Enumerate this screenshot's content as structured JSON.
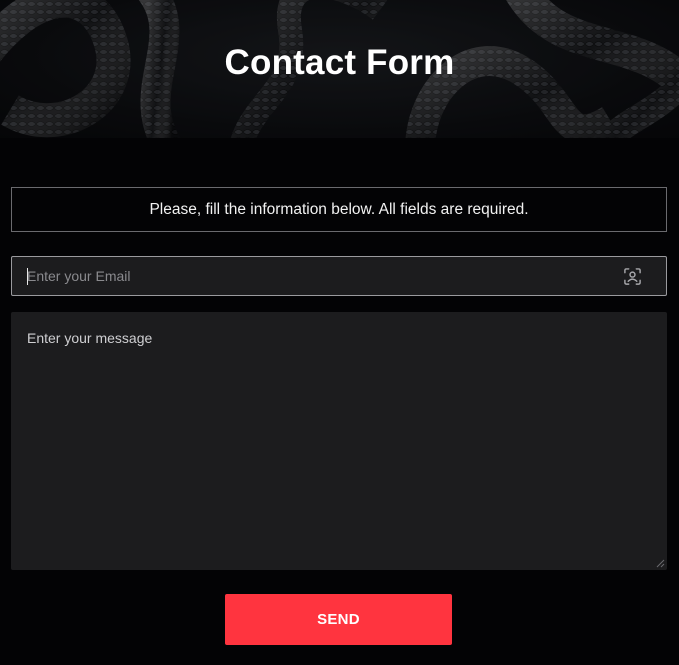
{
  "header": {
    "title": "Contact Form"
  },
  "form": {
    "info_text": "Please, fill the information below. All fields are required.",
    "email": {
      "placeholder": "Enter your Email",
      "value": ""
    },
    "message": {
      "placeholder": "Enter your message",
      "value": ""
    },
    "send_label": "SEND"
  },
  "icons": {
    "email_field_icon": "contact-card-icon",
    "textarea_resize": "resize-handle-icon"
  },
  "colors": {
    "background": "#030305",
    "field_background": "#1c1c1e",
    "accent": "#ff343f",
    "text": "#ffffff"
  }
}
